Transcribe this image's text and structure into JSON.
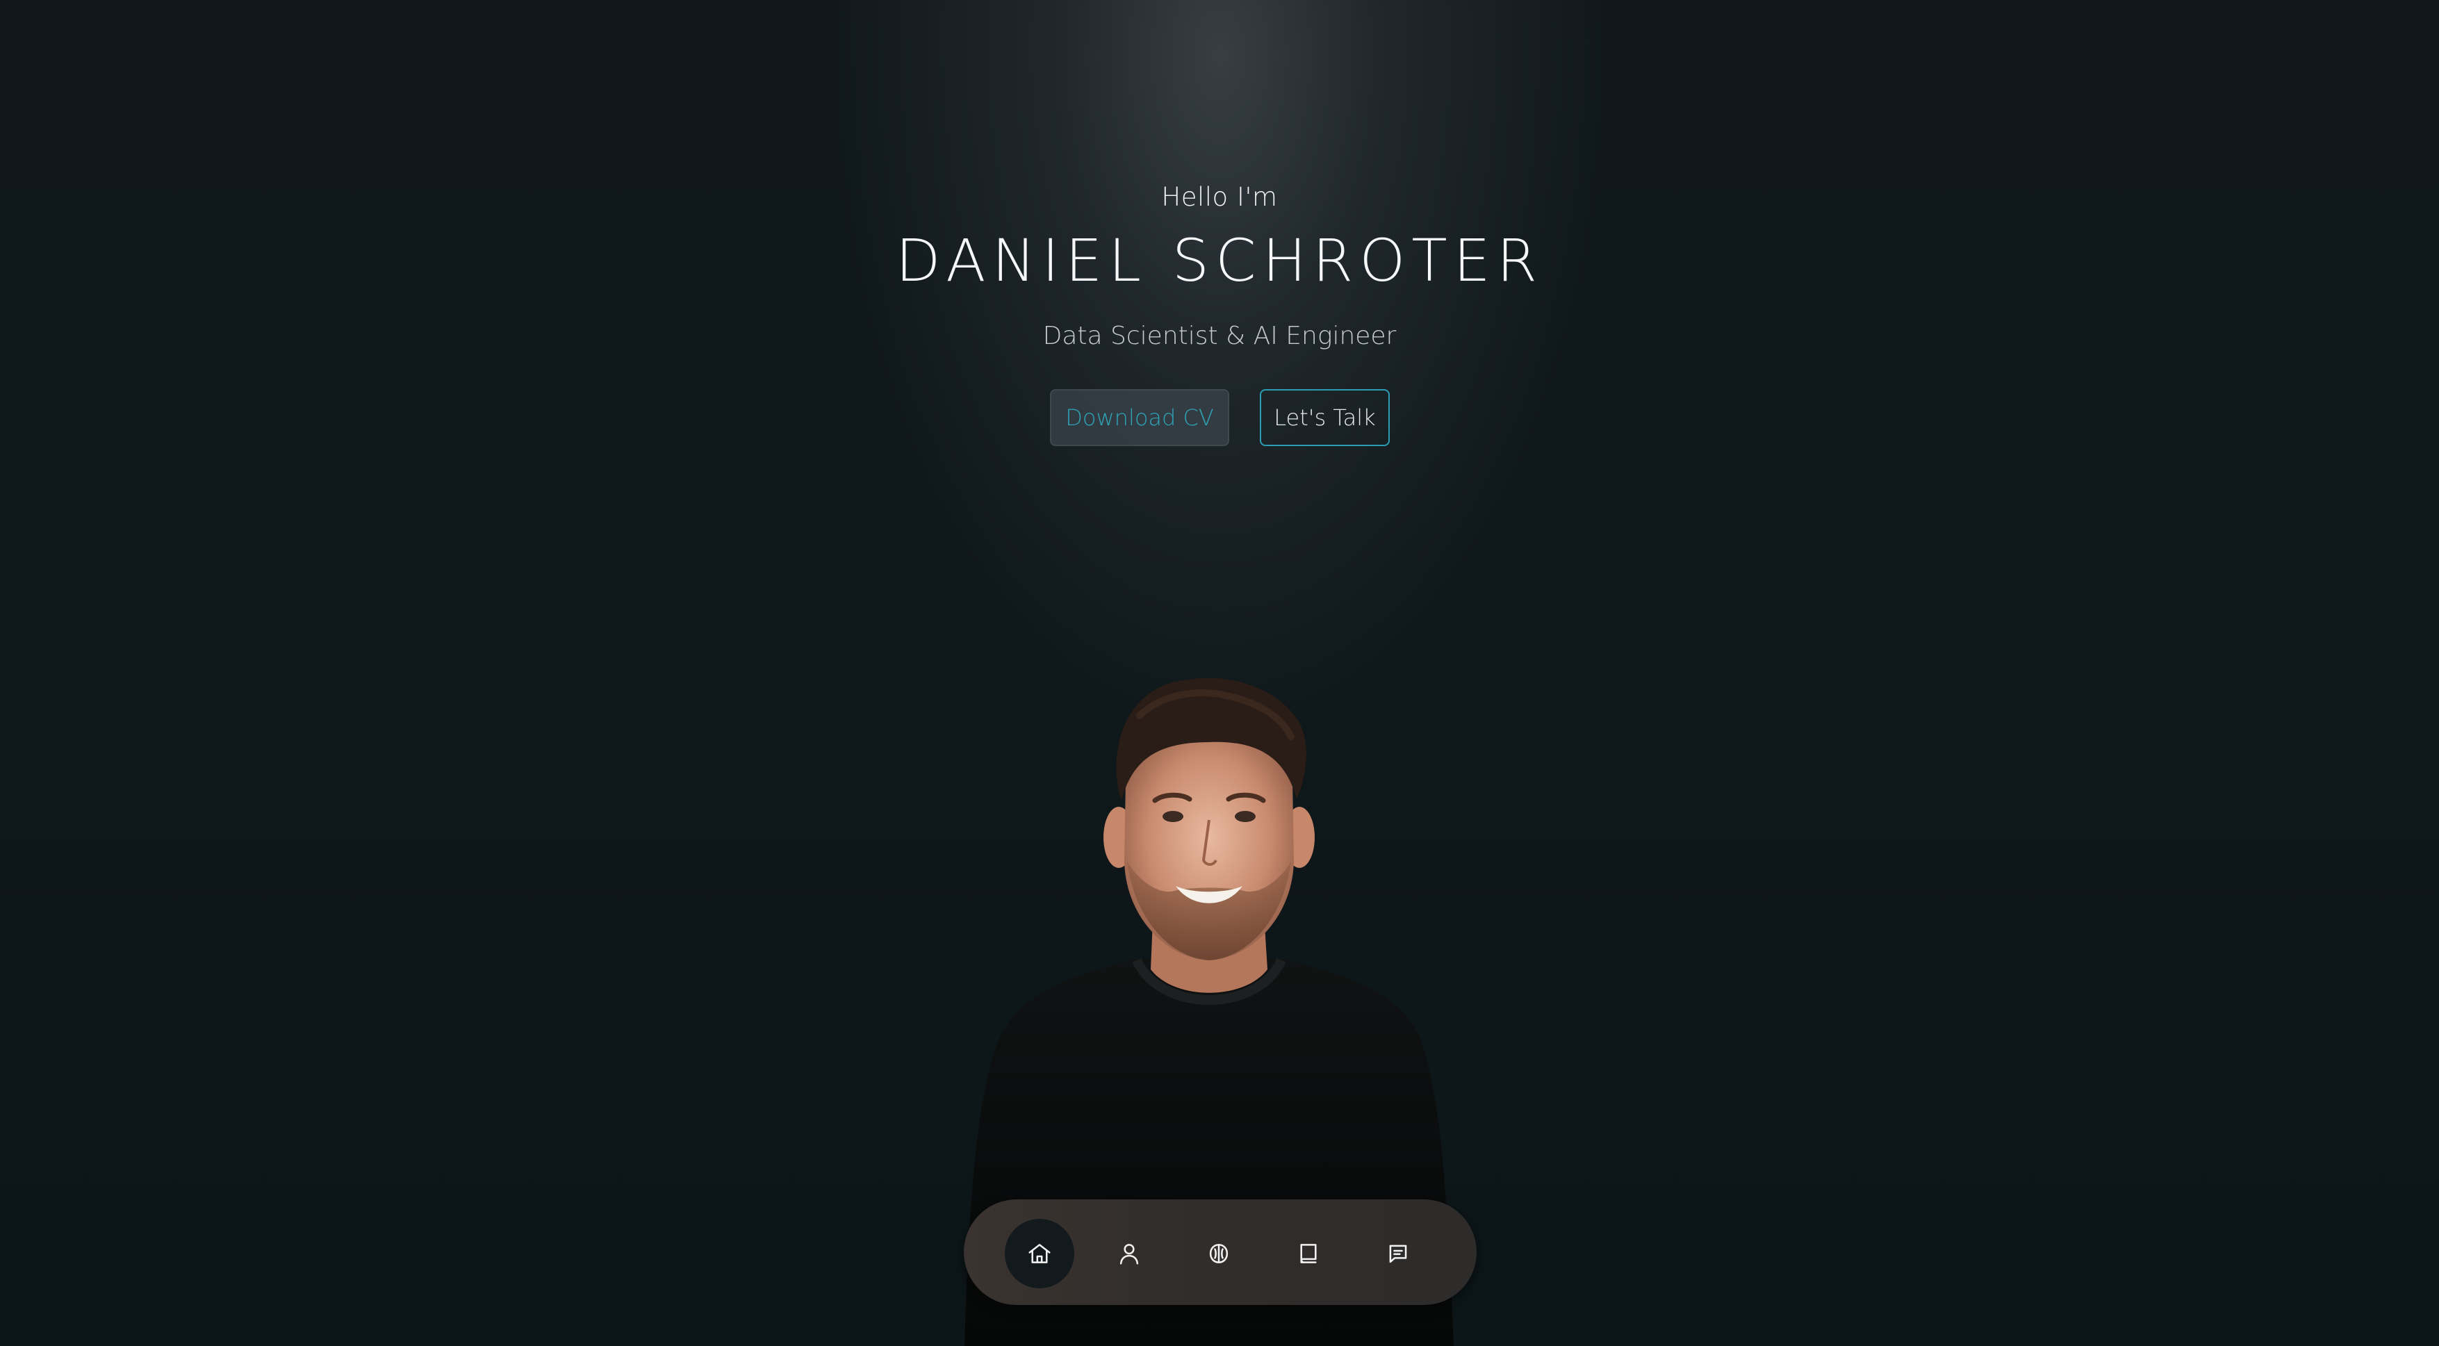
{
  "hero": {
    "greeting": "Hello I'm",
    "name": "DANIEL SCHROTER",
    "role": "Data Scientist & AI Engineer"
  },
  "actions": {
    "download_cv": "Download CV",
    "lets_talk": "Let's Talk"
  },
  "colors": {
    "accent": "#2a9db2",
    "background": "#0c1417",
    "text": "#f5f7f8"
  },
  "nav": {
    "items": [
      {
        "icon": "home-icon",
        "active": true
      },
      {
        "icon": "user-icon",
        "active": false
      },
      {
        "icon": "brain-icon",
        "active": false
      },
      {
        "icon": "book-icon",
        "active": false
      },
      {
        "icon": "message-icon",
        "active": false
      }
    ]
  }
}
